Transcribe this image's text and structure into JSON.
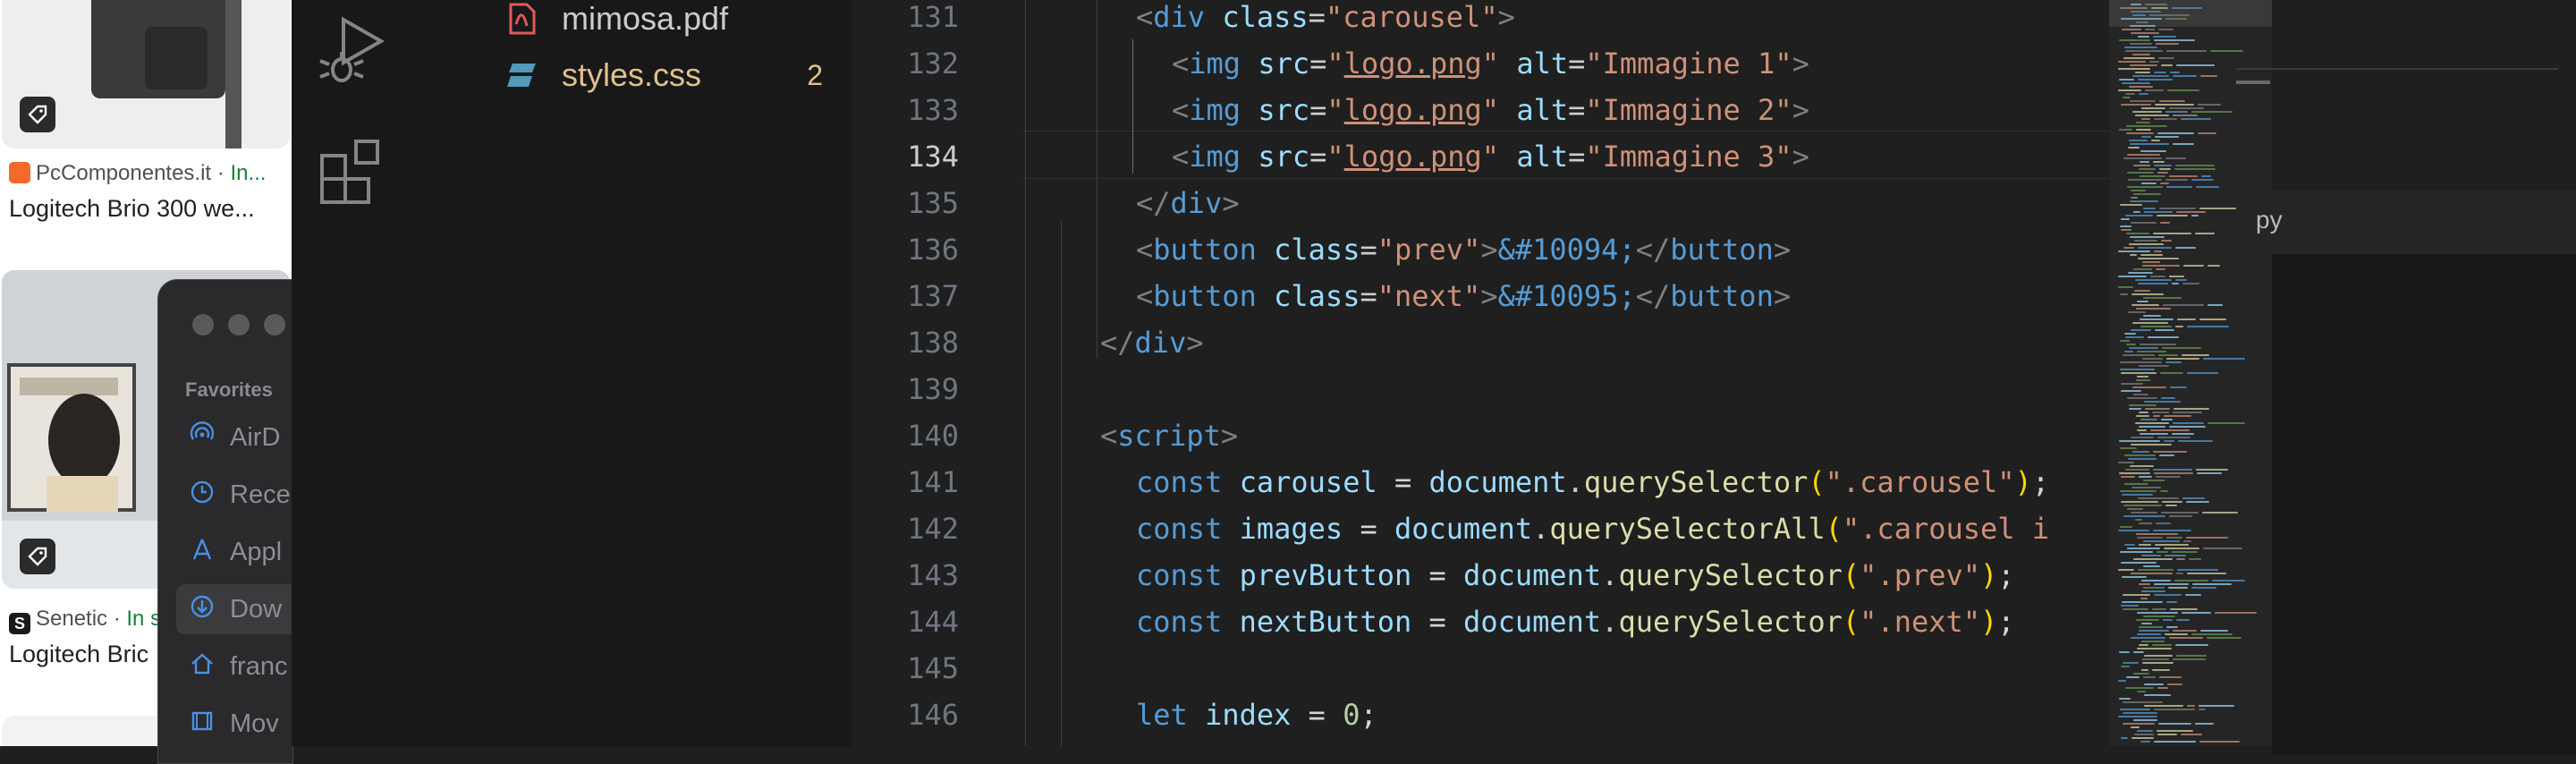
{
  "browser": {
    "results": [
      {
        "source": "PcComponentes.it",
        "stock": "In...",
        "title": "Logitech Brio 300 we...",
        "favicon_color": "#f36a2c"
      },
      {
        "source": "Senetic",
        "stock": "In s",
        "title": "Logitech Bric",
        "favicon_color": "#1a1a1a",
        "favicon_letter": "S"
      }
    ],
    "separator": " · "
  },
  "finder": {
    "section": "Favorites",
    "items": [
      {
        "label": "AirD",
        "icon": "airdrop-icon"
      },
      {
        "label": "Rece",
        "icon": "clock-icon"
      },
      {
        "label": "Appl",
        "icon": "applications-icon"
      },
      {
        "label": "Dow",
        "icon": "download-icon",
        "selected": true
      },
      {
        "label": "franc",
        "icon": "home-icon"
      },
      {
        "label": "Mov",
        "icon": "movies-icon"
      }
    ]
  },
  "explorer": {
    "files": [
      {
        "name": "mimosa.pdf",
        "icon": "pdf-icon",
        "color": "#cccccc",
        "icon_color": "#e05a5a",
        "badge": ""
      },
      {
        "name": "styles.css",
        "icon": "css-icon",
        "color": "#e2c08d",
        "icon_color": "#519aba",
        "badge": "2"
      }
    ]
  },
  "editor": {
    "active_line": "134",
    "line_numbers": [
      "131",
      "132",
      "133",
      "134",
      "135",
      "136",
      "137",
      "138",
      "139",
      "140",
      "141",
      "142",
      "143",
      "144",
      "145",
      "146"
    ],
    "code": {
      "l131": {
        "open": "<",
        "tag": "div",
        "attr": "class",
        "eq": "=",
        "val": "\"carousel\"",
        "close": ">"
      },
      "l132": {
        "open": "<",
        "tag": "img",
        "a1": "src",
        "eq": "=",
        "q": "\"",
        "link": "logo.png",
        "a2": "alt",
        "v2": "\"Immagine 1\"",
        "close": ">"
      },
      "l133": {
        "open": "<",
        "tag": "img",
        "a1": "src",
        "eq": "=",
        "q": "\"",
        "link": "logo.png",
        "a2": "alt",
        "v2": "\"Immagine 2\"",
        "close": ">"
      },
      "l134": {
        "open": "<",
        "tag": "img",
        "a1": "src",
        "eq": "=",
        "q": "\"",
        "link": "logo.png",
        "a2": "alt",
        "v2": "\"Immagine 3\"",
        "close": ">"
      },
      "l135": {
        "open": "</",
        "tag": "div",
        "close": ">"
      },
      "l136": {
        "open": "<",
        "tag": "button",
        "attr": "class",
        "eq": "=",
        "val": "\"prev\"",
        "close": ">",
        "entity": "&#10094;",
        "endopen": "</",
        "endtag": "button",
        "endclose": ">"
      },
      "l137": {
        "open": "<",
        "tag": "button",
        "attr": "class",
        "eq": "=",
        "val": "\"next\"",
        "close": ">",
        "entity": "&#10095;",
        "endopen": "</",
        "endtag": "button",
        "endclose": ">"
      },
      "l138": {
        "open": "</",
        "tag": "div",
        "close": ">"
      },
      "l140": {
        "open": "<",
        "tag": "script",
        "close": ">"
      },
      "l141": {
        "kw": "const",
        "name": "carousel",
        "op": "=",
        "obj": "document",
        "fn": "querySelector",
        "po": "(",
        "arg": "\".carousel\"",
        "pc": ")",
        "semi": ";"
      },
      "l142": {
        "kw": "const",
        "name": "images",
        "op": "=",
        "obj": "document",
        "fn": "querySelectorAll",
        "po": "(",
        "arg": "\".carousel i"
      },
      "l143": {
        "kw": "const",
        "name": "prevButton",
        "op": "=",
        "obj": "document",
        "fn": "querySelector",
        "po": "(",
        "arg": "\".prev\"",
        "pc": ")",
        "semi": ";"
      },
      "l144": {
        "kw": "const",
        "name": "nextButton",
        "op": "=",
        "obj": "document",
        "fn": "querySelector",
        "po": "(",
        "arg": "\".next\"",
        "pc": ")",
        "semi": ";"
      },
      "l146": {
        "kw": "let",
        "name": "index",
        "op": "=",
        "num": "0",
        "semi": ";"
      }
    }
  },
  "right_panel": {
    "tab_label": "py"
  }
}
